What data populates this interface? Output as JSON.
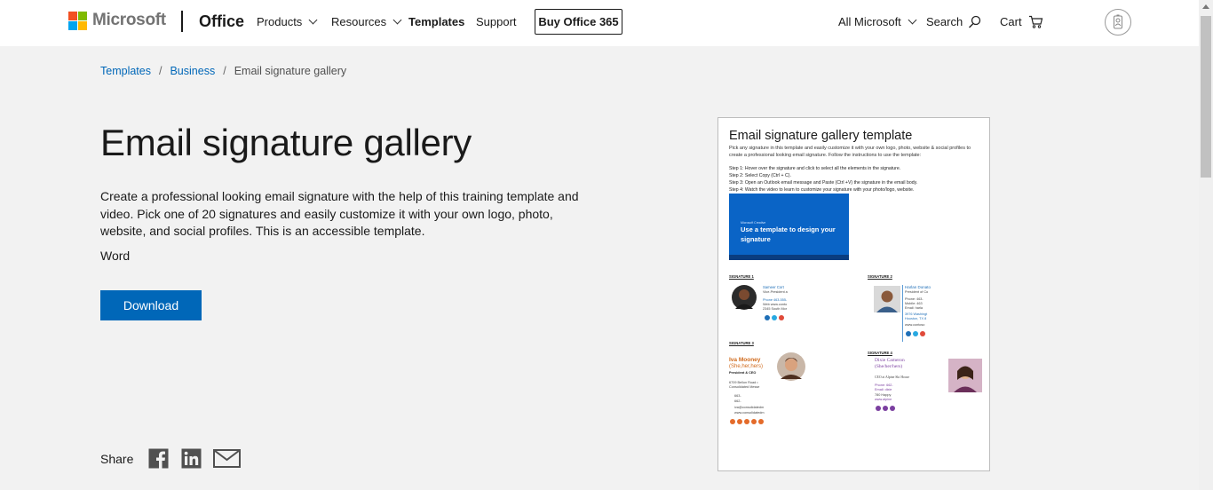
{
  "header": {
    "brand": "Microsoft",
    "product": "Office",
    "nav": {
      "products": "Products",
      "resources": "Resources",
      "templates": "Templates",
      "support": "Support"
    },
    "buy_button": "Buy Office 365",
    "all_microsoft": "All Microsoft",
    "search": "Search",
    "cart": "Cart"
  },
  "breadcrumb": {
    "items": [
      "Templates",
      "Business"
    ],
    "separator": "/",
    "current": "Email signature gallery"
  },
  "page": {
    "title": "Email signature gallery",
    "description": "Create a professional looking email signature with the help of this training template and video. Pick one of 20 signatures and easily customize it with your own logo, photo, website, and social profiles. This is an accessible template.",
    "app": "Word",
    "download_label": "Download",
    "share_label": "Share"
  },
  "preview": {
    "title": "Email signature gallery template",
    "intro": "Pick any signature in this template and easily customize it with your own logo, photo, website & social profiles to create a professional looking email signature. Follow the instructions to use the template:",
    "steps": [
      "Step 1: Hover over the signature and click to select all the elements in the signature.",
      "Step 2: Select Copy (Ctrl + C).",
      "Step 3: Open an Outlook email message and Paste (Ctrl +V) the signature in the email body.",
      "Step 4: Watch the video to learn to customize your signature with your photo/logo, website."
    ],
    "video_small": "Microsoft Creative",
    "video_title": "Use a template to design your signature",
    "signatures": {
      "s1": {
        "label": "SIGNATURE 1",
        "name": "Sameer Cort",
        "role": "Vice-President a",
        "lines": [
          "Phone 463-555-",
          "Web www.conto",
          "2345 South Mor"
        ]
      },
      "s2": {
        "label": "SIGNATURE 2",
        "name": "Harlan Donato",
        "role": "President of Co",
        "lines": [
          "Phone: 463-",
          "Mobile: 463",
          "Email: harla",
          "3976 Washingt",
          "Houston, TX 8",
          "www.contoso"
        ]
      },
      "s3": {
        "label": "SIGNATURE 3",
        "name": "Iva Mooney",
        "pronoun": "(She,her,hers)",
        "role": "President & CEO",
        "lines": [
          "6709 Bellon Road •",
          "Consolidated Messe",
          "663-",
          "662-",
          "iva@consolidatedm",
          "www.consolidatedm"
        ]
      },
      "s4": {
        "label": "SIGNATURE 4",
        "name": "Dixie Cameron",
        "pronoun": "(She/her/hers)",
        "lines": [
          "CEO at Alpine Ski House",
          "Phone: 662-",
          "Email: dixie",
          "780 Happy",
          "www.alpine"
        ]
      }
    }
  },
  "colors": {
    "accent": "#0067b8",
    "ms_red": "#f25022",
    "ms_green": "#7fba00",
    "ms_blue": "#00a4ef",
    "ms_yellow": "#ffb900",
    "video_blue": "#0a64c6",
    "sig3_orange": "#d06a1c",
    "sig4_purple": "#7b3fa0"
  },
  "icons": [
    "chevron-down-icon",
    "search-icon",
    "cart-icon",
    "account-icon",
    "facebook-icon",
    "linkedin-icon",
    "mail-icon"
  ]
}
